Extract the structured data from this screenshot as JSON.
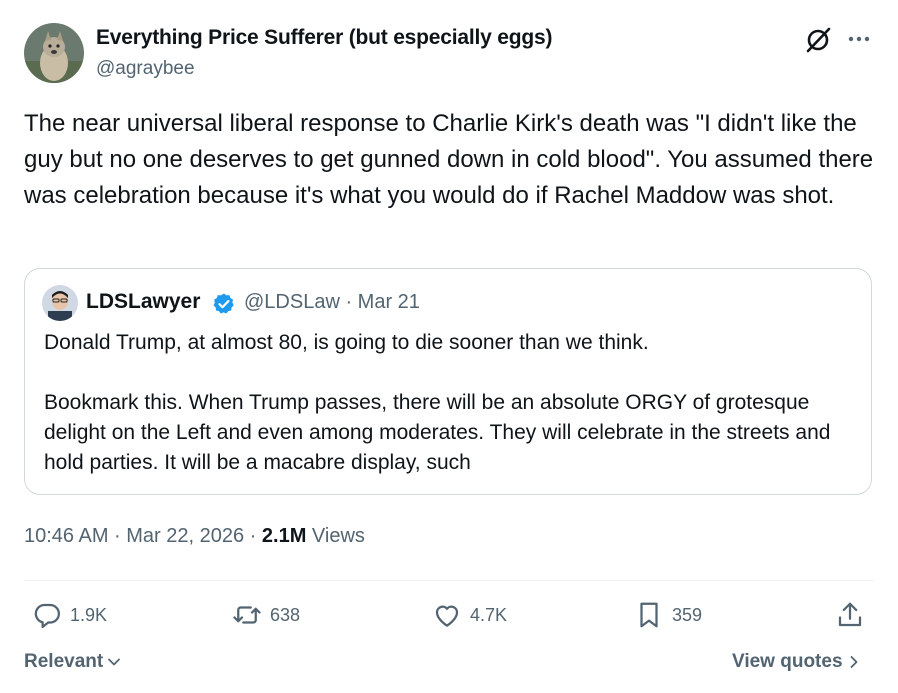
{
  "author": {
    "display_name": "Everything Price Sufferer (but especially eggs)",
    "handle": "@agraybee"
  },
  "tweet": {
    "text": "The near universal liberal response to Charlie Kirk's death was \"I didn't like the guy but no one deserves to get gunned down in cold blood\". You assumed there was celebration because it's what you would do if Rachel Maddow was shot."
  },
  "quote": {
    "name": "LDSLawyer",
    "meta": "@LDSLaw · Mar 21",
    "paragraph1": "Donald Trump, at almost 80, is going to die sooner than we think.",
    "paragraph2": "Bookmark this. When Trump passes, there will be an absolute ORGY of grotesque delight on the Left and even among moderates. They will celebrate in the streets and hold parties. It will be a macabre display, such"
  },
  "info": {
    "time_date": "10:46 AM · Mar 22, 2026 · ",
    "views_count": "2.1M",
    "views_label": " Views"
  },
  "actions": {
    "replies": "1.9K",
    "reposts": "638",
    "likes": "4.7K",
    "bookmarks": "359"
  },
  "footer": {
    "sort_label": "Relevant",
    "quotes_label": "View quotes"
  },
  "colors": {
    "text": "#0f1419",
    "secondary": "#536471",
    "border": "#cfd9de",
    "verified": "#1d9bf0"
  }
}
